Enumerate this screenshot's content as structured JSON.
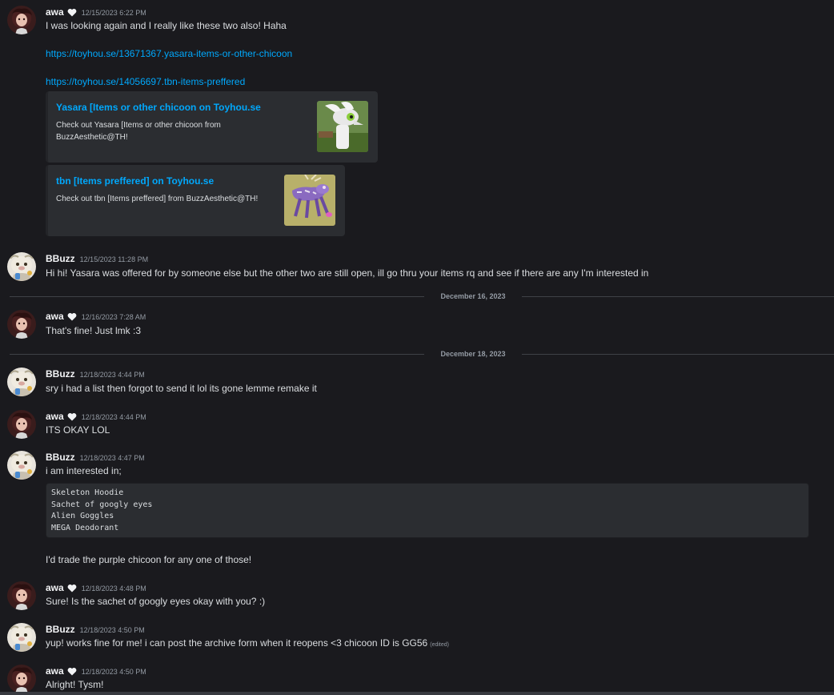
{
  "messages": [
    {
      "author": "awa",
      "heart": true,
      "timestamp": "12/15/2023 6:22 PM",
      "lines": [
        "I was looking again and I really like these two also! Haha"
      ],
      "links": [
        "https://toyhou.se/13671367.yasara-items-or-other-chicoon",
        "https://toyhou.se/14056697.tbn-items-preffered"
      ],
      "embeds": [
        {
          "title": "Yasara [Items or other chicoon on Toyhou.se",
          "description": [
            "Check out Yasara [Items or other chicoon from",
            "BuzzAesthetic@TH!"
          ]
        },
        {
          "title": "tbn [Items preffered] on Toyhou.se",
          "description": [
            "Check out tbn [Items preffered] from BuzzAesthetic@TH!"
          ]
        }
      ]
    },
    {
      "author": "BBuzz",
      "timestamp": "12/15/2023 11:28 PM",
      "lines": [
        "Hi hi! Yasara was offered for by someone else but the other two are still open, ill go thru your items rq and see if there are any I'm interested in"
      ]
    },
    {
      "author": "awa",
      "heart": true,
      "timestamp": "12/16/2023 7:28 AM",
      "lines": [
        "That's fine! Just lmk :3"
      ]
    },
    {
      "author": "BBuzz",
      "timestamp": "12/18/2023 4:44 PM",
      "lines": [
        "sry i had a list then forgot to send it lol its gone lemme remake it"
      ]
    },
    {
      "author": "awa",
      "heart": true,
      "timestamp": "12/18/2023 4:44 PM",
      "lines": [
        "ITS OKAY LOL"
      ]
    },
    {
      "author": "BBuzz",
      "timestamp": "12/18/2023 4:47 PM",
      "lines": [
        "i am interested in;"
      ],
      "code": [
        "Skeleton Hoodie",
        "Sachet of googly eyes",
        "Alien Goggles",
        "MEGA Deodorant"
      ],
      "after": "I'd trade the purple chicoon for any one of those!"
    },
    {
      "author": "awa",
      "heart": true,
      "timestamp": "12/18/2023 4:48 PM",
      "lines": [
        "Sure! Is the sachet of googly eyes okay with you? :)"
      ]
    },
    {
      "author": "BBuzz",
      "timestamp": "12/18/2023 4:50 PM",
      "lines": [
        "yup! works fine for me! i can post the archive form when it reopens <3 chicoon ID is GG56"
      ],
      "edited": "(edited)"
    },
    {
      "author": "awa",
      "heart": true,
      "timestamp": "12/18/2023 4:50 PM",
      "lines": [
        "Alright! Tysm!"
      ]
    }
  ],
  "dividers": [
    "December 16, 2023",
    "December 18, 2023"
  ],
  "colors": {
    "link": "#00a8fc",
    "background": "#1a1a1e",
    "embed": "#2b2d31",
    "muted": "#949ba4"
  }
}
